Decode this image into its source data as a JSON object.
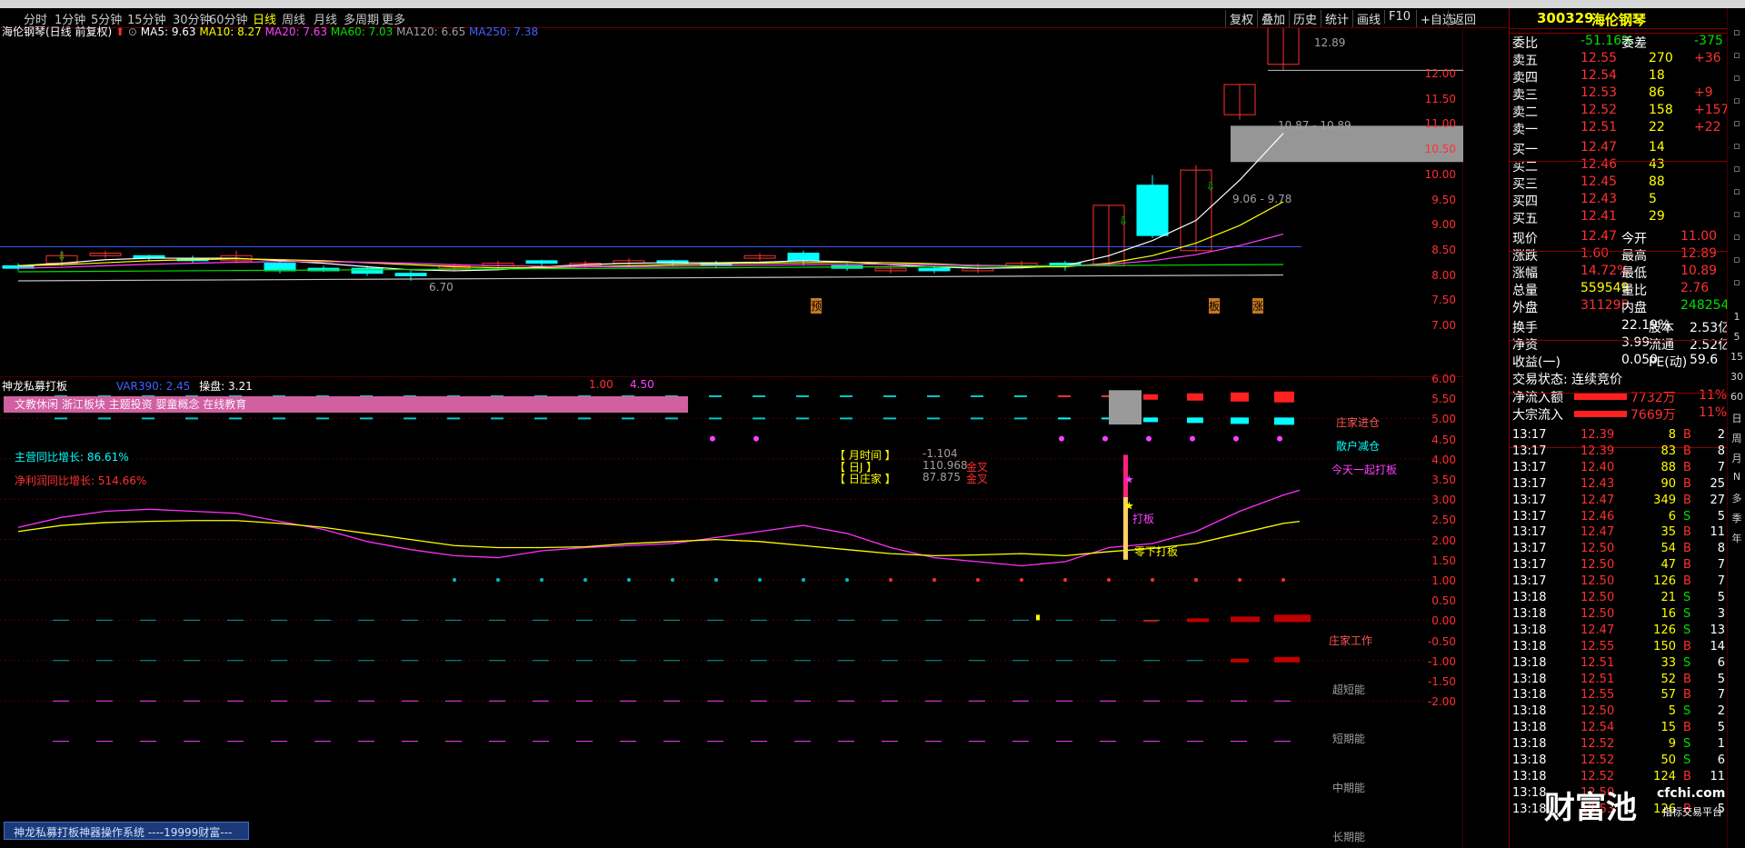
{
  "toolbar": {
    "tabs": [
      "分时",
      "1分钟",
      "5分钟",
      "15分钟",
      "30分钟",
      "60分钟",
      "日线",
      "周线",
      "月线",
      "多周期",
      "更多"
    ],
    "active": "日线",
    "buttons": [
      "复权",
      "叠加",
      "历史",
      "统计",
      "画线",
      "F10",
      "+自选",
      "返回"
    ]
  },
  "stock": {
    "code": "300329",
    "name": "海伦钢琴"
  },
  "main_legend": {
    "title": "海伦钢琴(日线 前复权)",
    "ma5": "MA5: 9.63",
    "ma10": "MA10: 8.27",
    "ma20": "MA20: 7.63",
    "ma60": "MA60: 7.03",
    "ma120": "MA120: 6.65",
    "ma250": "MA250: 7.38"
  },
  "main_labels": {
    "high": "12.89",
    "box1": "10.87 - 10.89",
    "box2": "9.06 - 9.78",
    "low": "6.70",
    "marks": [
      "预",
      "板",
      "涨"
    ]
  },
  "main_axis": [
    "12.00",
    "11.50",
    "11.00",
    "10.50",
    "10.00",
    "9.50",
    "9.00",
    "8.50",
    "8.00",
    "7.50",
    "7.00"
  ],
  "sub_legend": {
    "title": "神龙私募打板",
    "var": "VAR390: 2.45",
    "op": "操盘: 3.21",
    "v1": "1.00",
    "v2": "4.50"
  },
  "sub_banner": "文教休闲 浙江板块 主题投资 婴童概念 在线教育",
  "sub_info": {
    "rev": "主营同比增长: 86.61%",
    "profit": "净利润同比增长: 514.66%"
  },
  "sub_table": [
    {
      "k": "【 月时间 】",
      "v": "-1.104",
      "s": ""
    },
    {
      "k": "【 日J 】",
      "v": "110.968",
      "s": "金叉"
    },
    {
      "k": "【 日庄家 】",
      "v": "87.875",
      "s": "金叉"
    }
  ],
  "sub_tags": {
    "in": "庄家进仓",
    "out": "散户减仓",
    "today": "今天一起打板",
    "daban": "打板",
    "lingxia": "零下打板",
    "work": "庄家工作",
    "ultra": "超短能",
    "short": "短期能",
    "mid": "中期能",
    "long": "长期能"
  },
  "sub_axis": [
    "6.00",
    "5.50",
    "5.00",
    "4.50",
    "4.00",
    "3.50",
    "3.00",
    "2.50",
    "2.00",
    "1.50",
    "1.00",
    "0.50",
    "0.00",
    "-0.50",
    "-1.00",
    "-1.50",
    "-2.00"
  ],
  "footer_box": "神龙私募打板神器操作系统 ----19999财富---",
  "quote": {
    "weibi": {
      "label": "委比",
      "value": "-51.16%",
      "label2": "委差",
      "value2": "-375"
    },
    "asks": [
      {
        "l": "卖五",
        "p": "12.55",
        "v": "270",
        "c": "+36"
      },
      {
        "l": "卖四",
        "p": "12.54",
        "v": "18",
        "c": ""
      },
      {
        "l": "卖三",
        "p": "12.53",
        "v": "86",
        "c": "+9"
      },
      {
        "l": "卖二",
        "p": "12.52",
        "v": "158",
        "c": "+157"
      },
      {
        "l": "卖一",
        "p": "12.51",
        "v": "22",
        "c": "+22"
      }
    ],
    "bids": [
      {
        "l": "买一",
        "p": "12.47",
        "v": "14"
      },
      {
        "l": "买二",
        "p": "12.46",
        "v": "43"
      },
      {
        "l": "买三",
        "p": "12.45",
        "v": "88"
      },
      {
        "l": "买四",
        "p": "12.43",
        "v": "5"
      },
      {
        "l": "买五",
        "p": "12.41",
        "v": "29"
      }
    ],
    "stats": [
      {
        "l": "现价",
        "v": "12.47",
        "l2": "今开",
        "v2": "11.00"
      },
      {
        "l": "涨跌",
        "v": "1.60",
        "l2": "最高",
        "v2": "12.89"
      },
      {
        "l": "涨幅",
        "v": "14.72%",
        "l2": "最低",
        "v2": "10.89"
      },
      {
        "l": "总量",
        "v": "559549",
        "l2": "量比",
        "v2": "2.76"
      },
      {
        "l": "外盘",
        "v": "311295",
        "l2": "内盘",
        "v2": "248254"
      }
    ],
    "stats2": [
      {
        "l": "换手",
        "v": "22.19%",
        "l2": "股本",
        "v2": "2.53亿"
      },
      {
        "l": "净资",
        "v": "3.99",
        "l2": "流通",
        "v2": "2.52亿"
      },
      {
        "l": "收益(一)",
        "v": "0.050",
        "l2": "PE(动)",
        "v2": "59.6"
      }
    ],
    "status": "交易状态: 连续竞价",
    "flows": [
      {
        "l": "净流入额",
        "v": "7732万",
        "p": "11%"
      },
      {
        "l": "大宗流入",
        "v": "7669万",
        "p": "11%"
      }
    ]
  },
  "trades": [
    {
      "t": "13:17",
      "p": "12.39",
      "v": "8",
      "d": "B",
      "n": "2"
    },
    {
      "t": "13:17",
      "p": "12.39",
      "v": "83",
      "d": "B",
      "n": "8"
    },
    {
      "t": "13:17",
      "p": "12.40",
      "v": "88",
      "d": "B",
      "n": "7"
    },
    {
      "t": "13:17",
      "p": "12.43",
      "v": "90",
      "d": "B",
      "n": "25"
    },
    {
      "t": "13:17",
      "p": "12.47",
      "v": "349",
      "d": "B",
      "n": "27"
    },
    {
      "t": "13:17",
      "p": "12.46",
      "v": "6",
      "d": "S",
      "n": "5"
    },
    {
      "t": "13:17",
      "p": "12.47",
      "v": "35",
      "d": "B",
      "n": "11"
    },
    {
      "t": "13:17",
      "p": "12.50",
      "v": "54",
      "d": "B",
      "n": "8"
    },
    {
      "t": "13:17",
      "p": "12.50",
      "v": "47",
      "d": "B",
      "n": "7"
    },
    {
      "t": "13:17",
      "p": "12.50",
      "v": "126",
      "d": "B",
      "n": "7"
    },
    {
      "t": "13:18",
      "p": "12.50",
      "v": "21",
      "d": "S",
      "n": "5"
    },
    {
      "t": "13:18",
      "p": "12.50",
      "v": "16",
      "d": "S",
      "n": "3"
    },
    {
      "t": "13:18",
      "p": "12.47",
      "v": "126",
      "d": "S",
      "n": "13"
    },
    {
      "t": "13:18",
      "p": "12.55",
      "v": "150",
      "d": "B",
      "n": "14"
    },
    {
      "t": "13:18",
      "p": "12.51",
      "v": "33",
      "d": "S",
      "n": "6"
    },
    {
      "t": "13:18",
      "p": "12.51",
      "v": "52",
      "d": "B",
      "n": "5"
    },
    {
      "t": "13:18",
      "p": "12.55",
      "v": "57",
      "d": "B",
      "n": "7"
    },
    {
      "t": "13:18",
      "p": "12.50",
      "v": "5",
      "d": "S",
      "n": "2"
    },
    {
      "t": "13:18",
      "p": "12.54",
      "v": "15",
      "d": "B",
      "n": "5"
    },
    {
      "t": "13:18",
      "p": "12.52",
      "v": "9",
      "d": "S",
      "n": "1"
    },
    {
      "t": "13:18",
      "p": "12.52",
      "v": "50",
      "d": "S",
      "n": "6"
    },
    {
      "t": "13:18",
      "p": "12.52",
      "v": "124",
      "d": "B",
      "n": "11"
    },
    {
      "t": "13:18",
      "p": "12.50",
      "v": "",
      "d": "",
      "n": ""
    },
    {
      "t": "13:18",
      "p": "12.53",
      "v": "126",
      "d": "B",
      "n": "5"
    }
  ],
  "watermark": {
    "brand": "财富池",
    "site": "cfchi.com",
    "sub": "指标交易平台"
  },
  "sidebar": [
    "1",
    "5",
    "15",
    "30",
    "60",
    "日",
    "周",
    "月",
    "N",
    "多",
    "季",
    "年"
  ],
  "colors": {
    "up": "#ff3030",
    "down": "#00ffff",
    "ma5": "#ffffff",
    "ma10": "#ffff00",
    "ma20": "#ff40ff",
    "ma60": "#00e000"
  }
}
